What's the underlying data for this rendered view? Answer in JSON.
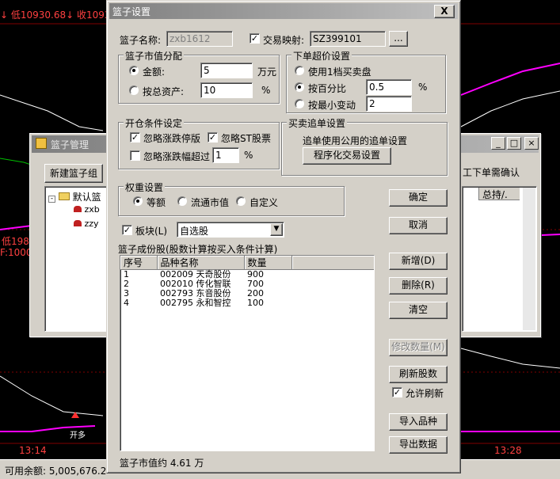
{
  "background": {
    "top_info": "↓ 低10930.68↓ 收1093",
    "left_info_1": "低198",
    "left_info_2": "F:1000",
    "open_label": "开多",
    "time_left": "13:14",
    "time_right": "13:28",
    "status_bar": "可用余额: 5,005,676.2",
    "right_label": "工下单需确认",
    "right_col": "总持/."
  },
  "basket_manager": {
    "title": "篮子管理",
    "new_basket_button": "新建篮子组",
    "tree_root": "默认篮",
    "tree_items": [
      "zxb",
      "zzy"
    ]
  },
  "dialog": {
    "title": "篮子设置",
    "close_glyph": "X",
    "basket_name_label": "篮子名称:",
    "basket_name_value": "zxb1612",
    "trade_map_label": "交易映射:",
    "trade_map_value": "SZ399101",
    "browse_button": "...",
    "market_value_group": "篮子市值分配",
    "amount_label": "金额:",
    "amount_value": "5",
    "amount_unit": "万元",
    "total_assets_label": "按总资产:",
    "total_assets_value": "10",
    "total_assets_unit": "%",
    "price_group": "下单超价设置",
    "price_opt1": "使用1档买卖盘",
    "price_opt2": "按百分比",
    "price_opt2_value": "0.5",
    "price_opt2_unit": "%",
    "price_opt3": "按最小变动",
    "price_opt3_value": "2",
    "open_cond_group": "开仓条件设定",
    "ignore_limit_up": "忽略涨跌停版",
    "ignore_st": "忽略ST股票",
    "ignore_change_over": "忽略涨跌幅超过",
    "ignore_change_value": "1",
    "ignore_change_unit": "%",
    "chase_group": "买卖追单设置",
    "chase_desc": "追单使用公用的追单设置",
    "program_trade_button": "程序化交易设置",
    "weight_group": "权重设置",
    "weight_opt1": "等额",
    "weight_opt2": "流通市值",
    "weight_opt3": "自定义",
    "sector_label": "板块(L)",
    "sector_value": "自选股",
    "component_label": "篮子成份股(股数计算按买入条件计算)",
    "columns": [
      "序号",
      "品种名称",
      "数量"
    ],
    "rows": [
      {
        "idx": "1",
        "name": "002009 天奇股份",
        "qty": "900"
      },
      {
        "idx": "2",
        "name": "002010 传化智联",
        "qty": "700"
      },
      {
        "idx": "3",
        "name": "002793 东音股份",
        "qty": "200"
      },
      {
        "idx": "4",
        "name": "002795 永和智控",
        "qty": "100"
      }
    ],
    "ok_button": "确定",
    "cancel_button": "取消",
    "add_button": "新增(D)",
    "delete_button": "删除(R)",
    "clear_button": "清空",
    "modify_qty_button": "修改数量(M)",
    "refresh_button": "刷新股数",
    "allow_refresh": "允许刷新",
    "import_button": "导入品种",
    "export_button": "导出数据",
    "market_value_status": "篮子市值约 4.61 万"
  }
}
